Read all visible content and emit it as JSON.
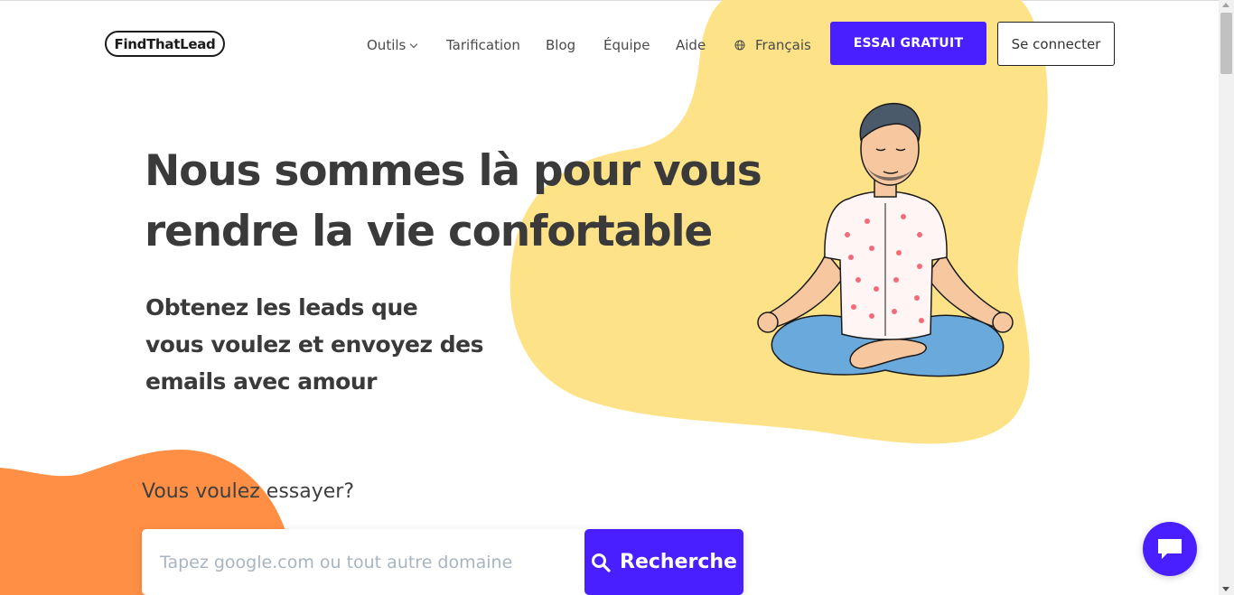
{
  "header": {
    "logo": "FindThatLead",
    "nav": {
      "tools": "Outils",
      "pricing": "Tarification",
      "blog": "Blog",
      "team": "Équipe",
      "help": "Aide",
      "language": "Français"
    },
    "trial_button": "ESSAI GRATUIT",
    "login_button": "Se connecter"
  },
  "hero": {
    "title_line1": "Nous sommes là pour vous",
    "title_line2": "rendre la vie confortable",
    "subtitle_line1": "Obtenez les leads que",
    "subtitle_line2": "vous voulez et envoyez des",
    "subtitle_line3": "emails avec amour"
  },
  "search": {
    "prompt": "Vous voulez essayer?",
    "placeholder": "Tapez google.com ou tout autre domaine",
    "button": "Recherche"
  },
  "colors": {
    "accent": "#4a1fff",
    "blob_yellow": "#fde287",
    "blob_orange": "#ff8f45",
    "text_dark": "#3a3a3a"
  },
  "icons": {
    "tools_dropdown": "chevron-down-icon",
    "language": "globe-icon",
    "search": "search-icon",
    "chat": "chat-icon"
  }
}
